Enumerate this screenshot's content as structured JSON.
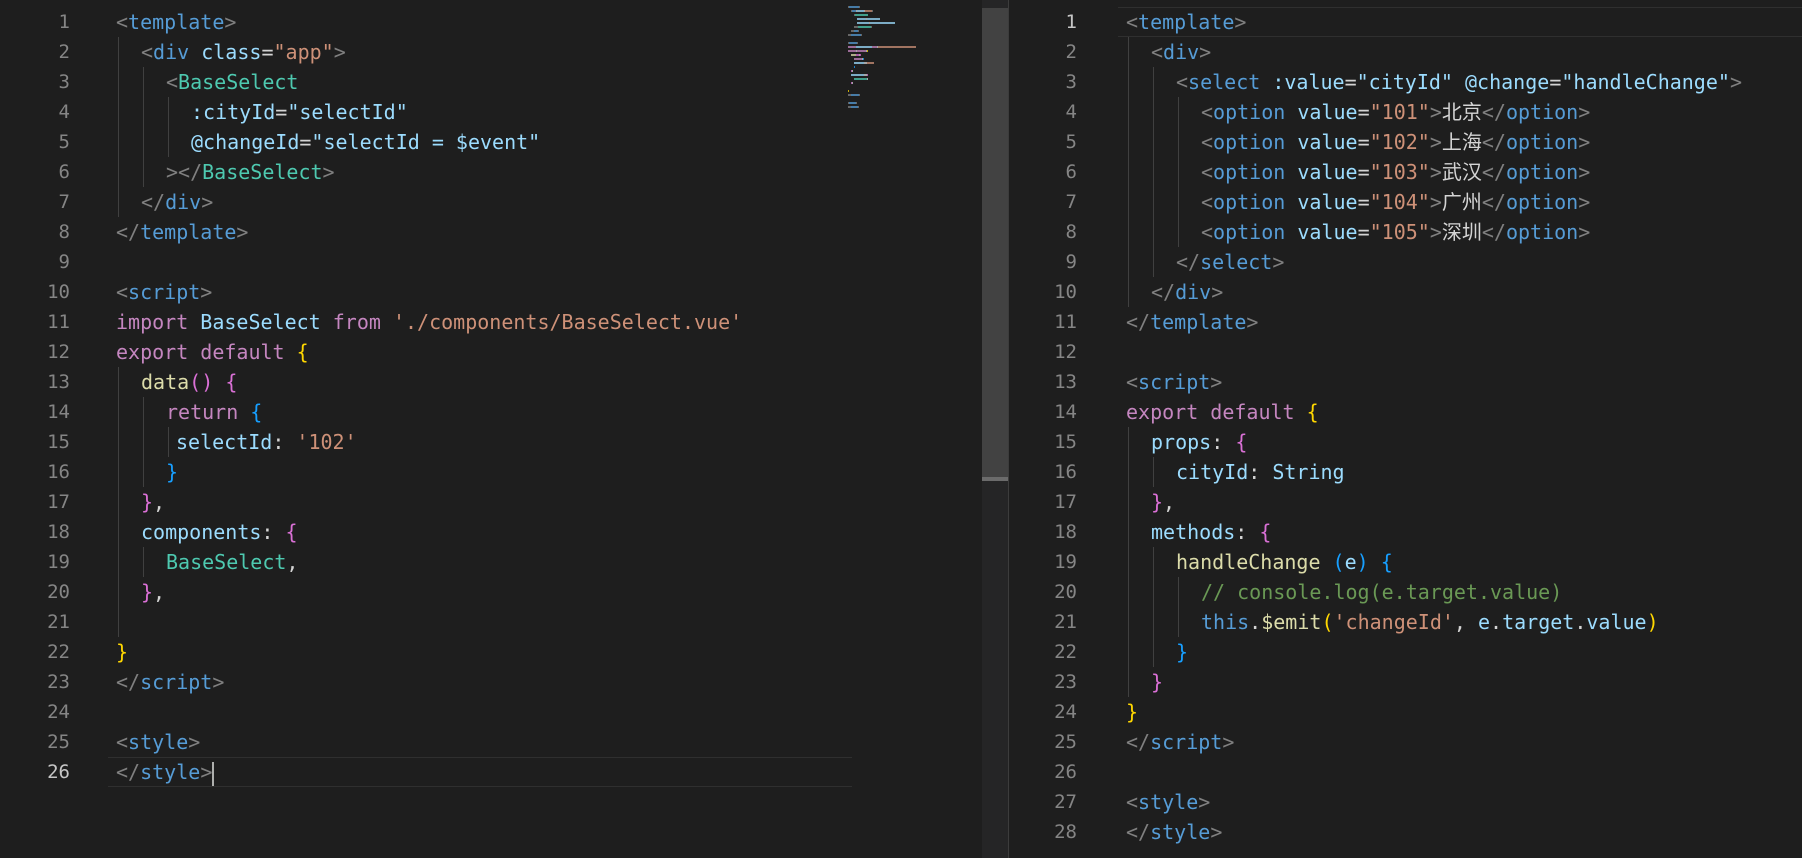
{
  "colors": {
    "background": "#1e1e1e",
    "tag_bracket": "#808080",
    "tag_name": "#569cd6",
    "component_tag": "#4ec9b0",
    "attribute": "#9cdcfe",
    "string": "#ce9178",
    "keyword": "#c586c0",
    "function": "#dcdcaa",
    "comment": "#6a9955",
    "bracket_gold": "#ffd700",
    "bracket_purple": "#da70d6",
    "bracket_blue": "#179fff",
    "plain": "#d4d4d4"
  },
  "left_editor": {
    "active_line": 26,
    "lines": [
      {
        "n": "1",
        "indent": 0,
        "t": [
          [
            "<",
            "tb"
          ],
          [
            "template",
            "tn"
          ],
          [
            ">",
            "tb"
          ]
        ]
      },
      {
        "n": "2",
        "indent": 1,
        "t": [
          [
            "<",
            "tb"
          ],
          [
            "div",
            "tn"
          ],
          [
            " ",
            "p"
          ],
          [
            "class",
            "at"
          ],
          [
            "=",
            "p"
          ],
          [
            "\"app\"",
            "st"
          ],
          [
            ">",
            "tb"
          ]
        ]
      },
      {
        "n": "3",
        "indent": 2,
        "t": [
          [
            "<",
            "tb"
          ],
          [
            "BaseSelect",
            "ct"
          ]
        ]
      },
      {
        "n": "4",
        "indent": 3,
        "t": [
          [
            ":cityId",
            "at"
          ],
          [
            "=",
            "p"
          ],
          [
            "\"selectId\"",
            "at"
          ]
        ]
      },
      {
        "n": "5",
        "indent": 3,
        "t": [
          [
            "@changeId",
            "at"
          ],
          [
            "=",
            "p"
          ],
          [
            "\"selectId = $event\"",
            "at"
          ]
        ]
      },
      {
        "n": "6",
        "indent": 2,
        "t": [
          [
            "></",
            "tb"
          ],
          [
            "BaseSelect",
            "ct"
          ],
          [
            ">",
            "tb"
          ]
        ]
      },
      {
        "n": "7",
        "indent": 1,
        "t": [
          [
            "</",
            "tb"
          ],
          [
            "div",
            "tn"
          ],
          [
            ">",
            "tb"
          ]
        ]
      },
      {
        "n": "8",
        "indent": 0,
        "t": [
          [
            "</",
            "tb"
          ],
          [
            "template",
            "tn"
          ],
          [
            ">",
            "tb"
          ]
        ]
      },
      {
        "n": "9",
        "indent": 0,
        "t": []
      },
      {
        "n": "10",
        "indent": 0,
        "t": [
          [
            "<",
            "tb"
          ],
          [
            "script",
            "tn"
          ],
          [
            ">",
            "tb"
          ]
        ]
      },
      {
        "n": "11",
        "indent": 0,
        "t": [
          [
            "import",
            "kw"
          ],
          [
            " BaseSelect ",
            "at"
          ],
          [
            "from",
            "kw"
          ],
          [
            " ",
            "p"
          ],
          [
            "'./components/BaseSelect.vue'",
            "st"
          ]
        ]
      },
      {
        "n": "12",
        "indent": 0,
        "t": [
          [
            "export",
            "kw"
          ],
          [
            " ",
            "p"
          ],
          [
            "default",
            "kw"
          ],
          [
            " ",
            "p"
          ],
          [
            "{",
            "bg"
          ]
        ]
      },
      {
        "n": "13",
        "indent": 1,
        "t": [
          [
            "data",
            "fn"
          ],
          [
            "()",
            "bp"
          ],
          [
            " ",
            "p"
          ],
          [
            "{",
            "bp"
          ]
        ]
      },
      {
        "n": "14",
        "indent": 2,
        "t": [
          [
            "return",
            "kw"
          ],
          [
            " ",
            "p"
          ],
          [
            "{",
            "bb"
          ]
        ]
      },
      {
        "n": "15",
        "indent": 2,
        "sub": true,
        "t": [
          [
            "selectId",
            "at"
          ],
          [
            ": ",
            "p"
          ],
          [
            "'102'",
            "st"
          ]
        ]
      },
      {
        "n": "16",
        "indent": 2,
        "t": [
          [
            "}",
            "bb"
          ]
        ]
      },
      {
        "n": "17",
        "indent": 1,
        "t": [
          [
            "}",
            "bp"
          ],
          [
            ",",
            "p"
          ]
        ]
      },
      {
        "n": "18",
        "indent": 1,
        "t": [
          [
            "components",
            "at"
          ],
          [
            ": ",
            "p"
          ],
          [
            "{",
            "bp"
          ]
        ]
      },
      {
        "n": "19",
        "indent": 2,
        "t": [
          [
            "BaseSelect",
            "ct"
          ],
          [
            ",",
            "p"
          ]
        ]
      },
      {
        "n": "20",
        "indent": 1,
        "t": [
          [
            "}",
            "bp"
          ],
          [
            ",",
            "p"
          ]
        ]
      },
      {
        "n": "21",
        "indent": 1,
        "t": []
      },
      {
        "n": "22",
        "indent": 0,
        "t": [
          [
            "}",
            "bg"
          ]
        ]
      },
      {
        "n": "23",
        "indent": 0,
        "t": [
          [
            "</",
            "tb"
          ],
          [
            "script",
            "tn"
          ],
          [
            ">",
            "tb"
          ]
        ]
      },
      {
        "n": "24",
        "indent": 0,
        "t": []
      },
      {
        "n": "25",
        "indent": 0,
        "t": [
          [
            "<",
            "tb"
          ],
          [
            "style",
            "tn"
          ],
          [
            ">",
            "tb"
          ]
        ]
      },
      {
        "n": "26",
        "indent": 0,
        "caret": true,
        "t": [
          [
            "</",
            "tb"
          ],
          [
            "style",
            "tn"
          ],
          [
            ">",
            "tb"
          ]
        ]
      }
    ]
  },
  "right_editor": {
    "active_line": 1,
    "lines": [
      {
        "n": "1",
        "indent": 0,
        "t": [
          [
            "<",
            "tb"
          ],
          [
            "template",
            "tn"
          ],
          [
            ">",
            "tb"
          ]
        ]
      },
      {
        "n": "2",
        "indent": 1,
        "t": [
          [
            "<",
            "tb"
          ],
          [
            "div",
            "tn"
          ],
          [
            ">",
            "tb"
          ]
        ]
      },
      {
        "n": "3",
        "indent": 2,
        "t": [
          [
            "<",
            "tb"
          ],
          [
            "select",
            "tn"
          ],
          [
            " ",
            "p"
          ],
          [
            ":value",
            "at"
          ],
          [
            "=",
            "p"
          ],
          [
            "\"cityId\"",
            "at"
          ],
          [
            " ",
            "p"
          ],
          [
            "@change",
            "at"
          ],
          [
            "=",
            "p"
          ],
          [
            "\"handleChange\"",
            "at"
          ],
          [
            ">",
            "tb"
          ]
        ]
      },
      {
        "n": "4",
        "indent": 3,
        "t": [
          [
            "<",
            "tb"
          ],
          [
            "option",
            "tn"
          ],
          [
            " ",
            "p"
          ],
          [
            "value",
            "at"
          ],
          [
            "=",
            "p"
          ],
          [
            "\"101\"",
            "st"
          ],
          [
            ">",
            "tb"
          ],
          [
            "北京",
            "p"
          ],
          [
            "</",
            "tb"
          ],
          [
            "option",
            "tn"
          ],
          [
            ">",
            "tb"
          ]
        ]
      },
      {
        "n": "5",
        "indent": 3,
        "t": [
          [
            "<",
            "tb"
          ],
          [
            "option",
            "tn"
          ],
          [
            " ",
            "p"
          ],
          [
            "value",
            "at"
          ],
          [
            "=",
            "p"
          ],
          [
            "\"102\"",
            "st"
          ],
          [
            ">",
            "tb"
          ],
          [
            "上海",
            "p"
          ],
          [
            "</",
            "tb"
          ],
          [
            "option",
            "tn"
          ],
          [
            ">",
            "tb"
          ]
        ]
      },
      {
        "n": "6",
        "indent": 3,
        "t": [
          [
            "<",
            "tb"
          ],
          [
            "option",
            "tn"
          ],
          [
            " ",
            "p"
          ],
          [
            "value",
            "at"
          ],
          [
            "=",
            "p"
          ],
          [
            "\"103\"",
            "st"
          ],
          [
            ">",
            "tb"
          ],
          [
            "武汉",
            "p"
          ],
          [
            "</",
            "tb"
          ],
          [
            "option",
            "tn"
          ],
          [
            ">",
            "tb"
          ]
        ]
      },
      {
        "n": "7",
        "indent": 3,
        "t": [
          [
            "<",
            "tb"
          ],
          [
            "option",
            "tn"
          ],
          [
            " ",
            "p"
          ],
          [
            "value",
            "at"
          ],
          [
            "=",
            "p"
          ],
          [
            "\"104\"",
            "st"
          ],
          [
            ">",
            "tb"
          ],
          [
            "广州",
            "p"
          ],
          [
            "</",
            "tb"
          ],
          [
            "option",
            "tn"
          ],
          [
            ">",
            "tb"
          ]
        ]
      },
      {
        "n": "8",
        "indent": 3,
        "t": [
          [
            "<",
            "tb"
          ],
          [
            "option",
            "tn"
          ],
          [
            " ",
            "p"
          ],
          [
            "value",
            "at"
          ],
          [
            "=",
            "p"
          ],
          [
            "\"105\"",
            "st"
          ],
          [
            ">",
            "tb"
          ],
          [
            "深圳",
            "p"
          ],
          [
            "</",
            "tb"
          ],
          [
            "option",
            "tn"
          ],
          [
            ">",
            "tb"
          ]
        ]
      },
      {
        "n": "9",
        "indent": 2,
        "t": [
          [
            "</",
            "tb"
          ],
          [
            "select",
            "tn"
          ],
          [
            ">",
            "tb"
          ]
        ]
      },
      {
        "n": "10",
        "indent": 1,
        "t": [
          [
            "</",
            "tb"
          ],
          [
            "div",
            "tn"
          ],
          [
            ">",
            "tb"
          ]
        ]
      },
      {
        "n": "11",
        "indent": 0,
        "t": [
          [
            "</",
            "tb"
          ],
          [
            "template",
            "tn"
          ],
          [
            ">",
            "tb"
          ]
        ]
      },
      {
        "n": "12",
        "indent": 0,
        "t": []
      },
      {
        "n": "13",
        "indent": 0,
        "t": [
          [
            "<",
            "tb"
          ],
          [
            "script",
            "tn"
          ],
          [
            ">",
            "tb"
          ]
        ]
      },
      {
        "n": "14",
        "indent": 0,
        "t": [
          [
            "export",
            "kw"
          ],
          [
            " ",
            "p"
          ],
          [
            "default",
            "kw"
          ],
          [
            " ",
            "p"
          ],
          [
            "{",
            "bg"
          ]
        ]
      },
      {
        "n": "15",
        "indent": 1,
        "t": [
          [
            "props",
            "at"
          ],
          [
            ": ",
            "p"
          ],
          [
            "{",
            "bp"
          ]
        ]
      },
      {
        "n": "16",
        "indent": 2,
        "t": [
          [
            "cityId",
            "at"
          ],
          [
            ": ",
            "p"
          ],
          [
            "String",
            "at"
          ]
        ]
      },
      {
        "n": "17",
        "indent": 1,
        "t": [
          [
            "}",
            "bp"
          ],
          [
            ",",
            "p"
          ]
        ]
      },
      {
        "n": "18",
        "indent": 1,
        "t": [
          [
            "methods",
            "at"
          ],
          [
            ": ",
            "p"
          ],
          [
            "{",
            "bp"
          ]
        ]
      },
      {
        "n": "19",
        "indent": 2,
        "t": [
          [
            "handleChange",
            "fn"
          ],
          [
            " ",
            "p"
          ],
          [
            "(",
            "bb"
          ],
          [
            "e",
            "at"
          ],
          [
            ")",
            "bb"
          ],
          [
            " ",
            "p"
          ],
          [
            "{",
            "bb"
          ]
        ]
      },
      {
        "n": "20",
        "indent": 3,
        "t": [
          [
            "// console.log(e.target.value)",
            "cm"
          ]
        ]
      },
      {
        "n": "21",
        "indent": 3,
        "t": [
          [
            "this",
            "tn"
          ],
          [
            ".",
            "p"
          ],
          [
            "$emit",
            "fn"
          ],
          [
            "(",
            "bg"
          ],
          [
            "'changeId'",
            "st"
          ],
          [
            ", ",
            "p"
          ],
          [
            "e",
            "at"
          ],
          [
            ".",
            "p"
          ],
          [
            "target",
            "at"
          ],
          [
            ".",
            "p"
          ],
          [
            "value",
            "at"
          ],
          [
            ")",
            "bg"
          ]
        ]
      },
      {
        "n": "22",
        "indent": 2,
        "t": [
          [
            "}",
            "bb"
          ]
        ]
      },
      {
        "n": "23",
        "indent": 1,
        "t": [
          [
            "}",
            "bp"
          ]
        ]
      },
      {
        "n": "24",
        "indent": 0,
        "t": [
          [
            "}",
            "bg"
          ]
        ]
      },
      {
        "n": "25",
        "indent": 0,
        "t": [
          [
            "</",
            "tb"
          ],
          [
            "script",
            "tn"
          ],
          [
            ">",
            "tb"
          ]
        ]
      },
      {
        "n": "26",
        "indent": 0,
        "t": []
      },
      {
        "n": "27",
        "indent": 0,
        "t": [
          [
            "<",
            "tb"
          ],
          [
            "style",
            "tn"
          ],
          [
            ">",
            "tb"
          ]
        ]
      },
      {
        "n": "28",
        "indent": 0,
        "t": [
          [
            "</",
            "tb"
          ],
          [
            "style",
            "tn"
          ],
          [
            ">",
            "tb"
          ]
        ]
      }
    ]
  }
}
